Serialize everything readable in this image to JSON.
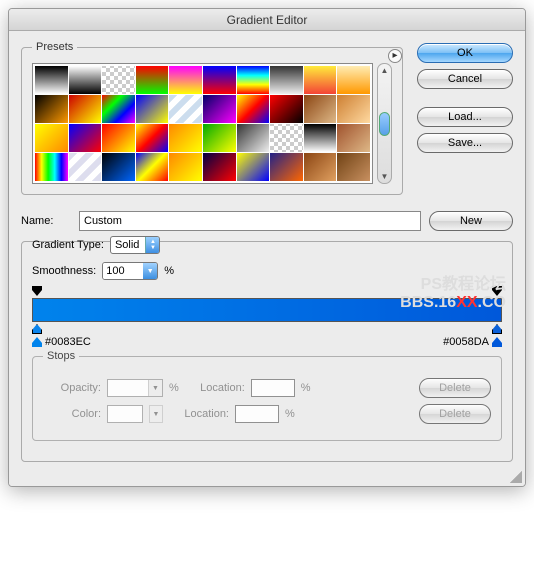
{
  "title": "Gradient Editor",
  "buttons": {
    "ok": "OK",
    "cancel": "Cancel",
    "load": "Load...",
    "save": "Save...",
    "new": "New",
    "delete": "Delete"
  },
  "presets": {
    "legend": "Presets",
    "swatches": [
      "linear-gradient(#000,#fff)",
      "linear-gradient(#fff,#000)",
      "repeating-conic-gradient(#ccc 0 25%, #fff 0 50%) 0/8px 8px",
      "linear-gradient(#f00,#0f0)",
      "linear-gradient(#f0f,#ff0)",
      "linear-gradient(#00f,#f00)",
      "linear-gradient(#00f,#0ff,#ff0,#f00)",
      "linear-gradient(#333,#eee)",
      "linear-gradient(#ffeb3b,#f44336)",
      "linear-gradient(#ffecb3,#ff9800)",
      "linear-gradient(135deg,#000,#f90)",
      "linear-gradient(135deg,#c00,#ff0)",
      "linear-gradient(135deg,#f00,#0f0,#00f,#f0f)",
      "linear-gradient(135deg,#00f,#ff0)",
      "repeating-linear-gradient(135deg,#cde 0 6px,#fff 6px 12px)",
      "linear-gradient(135deg,#006,#f0f)",
      "linear-gradient(135deg,#ff0,#f00,#00f)",
      "linear-gradient(135deg,#f00,#000)",
      "linear-gradient(135deg,#8b4513,#deb887)",
      "linear-gradient(135deg,#cd7f32,#ffd9a0)",
      "linear-gradient(135deg,#ff0,#f80)",
      "linear-gradient(135deg,#00f,#f00)",
      "linear-gradient(135deg,#f00,#ff0)",
      "linear-gradient(135deg,#ff0,#f00,#00f)",
      "linear-gradient(135deg,#f80,#ff0)",
      "linear-gradient(135deg,#0a0,#ff0)",
      "linear-gradient(135deg,#333,#eee)",
      "repeating-conic-gradient(#ccc 0 25%, #fff 0 50%) 0/8px 8px",
      "linear-gradient(#000,#fff)",
      "linear-gradient(135deg,#a0522d,#deb887)",
      "linear-gradient(90deg,#f00,#ff0,#0f0,#0ff,#00f,#f0f)",
      "repeating-linear-gradient(135deg,#dde 0 6px,#fff 6px 12px)",
      "linear-gradient(135deg,#000,#06f)",
      "linear-gradient(135deg,#00f,#ff0,#f00)",
      "linear-gradient(135deg,#f80,#ff0)",
      "linear-gradient(135deg,#004,#f00)",
      "linear-gradient(135deg,#ff0,#00f)",
      "linear-gradient(135deg,#228,#f60)",
      "linear-gradient(135deg,#8b4513,#e0a060)",
      "linear-gradient(135deg,#704214,#c89060)"
    ]
  },
  "name": {
    "label": "Name:",
    "value": "Custom"
  },
  "gradient_type": {
    "label": "Gradient Type:",
    "value": "Solid"
  },
  "smoothness": {
    "label": "Smoothness:",
    "value": "100",
    "suffix": "%"
  },
  "gradient": {
    "left_color": "#0083EC",
    "right_color": "#0058DA"
  },
  "stops": {
    "legend": "Stops",
    "opacity_label": "Opacity:",
    "color_label": "Color:",
    "location_label": "Location:",
    "percent": "%",
    "opacity_value": "",
    "opacity_location": "",
    "color_location": ""
  },
  "watermark": {
    "line1": "PS教程论坛",
    "line2_a": "BBS.16",
    "line2_xx": "XX",
    "line2_b": ".CO"
  }
}
